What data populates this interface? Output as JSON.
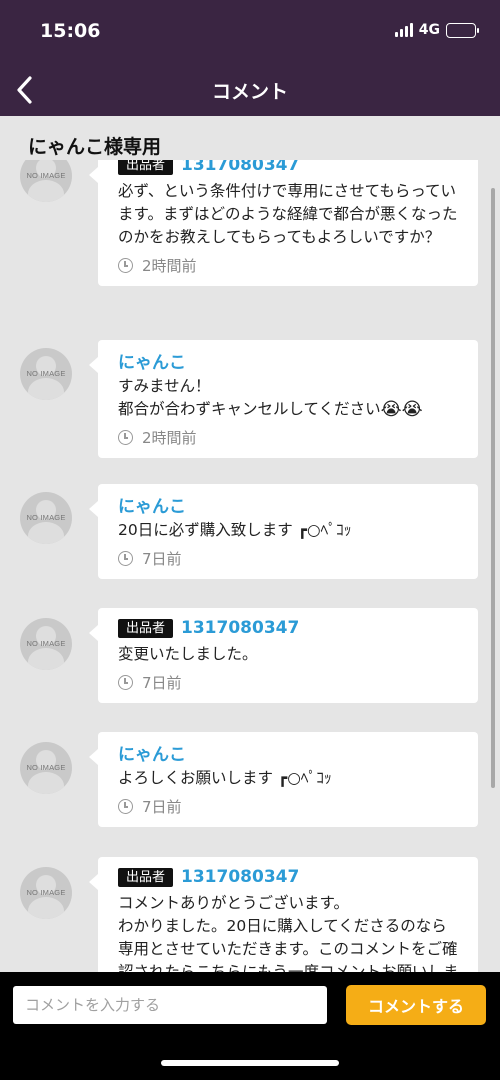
{
  "status_bar": {
    "time": "15:06",
    "network": "4G"
  },
  "nav": {
    "title": "コメント",
    "back_icon": "chevron-left-icon"
  },
  "section": {
    "title": "にゃんこ様専用"
  },
  "avatar_placeholder": "NO IMAGE",
  "seller_badge": "出品者",
  "comments": [
    {
      "author": "1317080347",
      "is_seller": true,
      "text": "必ず、という条件付けで専用にさせてもらっています。まずはどのような経緯で都合が悪くなったのかをお教えしてもらってもよろしいですか？",
      "time": "2時間前"
    },
    {
      "author": "にゃんこ",
      "is_seller": false,
      "text": "すみません！\n都合が合わずキャンセルしてください",
      "emoji": "😭😭",
      "time": "2時間前"
    },
    {
      "author": "にゃんこ",
      "is_seller": false,
      "text": "20日に必ず購入致します ┏○ﾍﾟｺｯ",
      "time": "7日前"
    },
    {
      "author": "1317080347",
      "is_seller": true,
      "text": "変更いたしました。",
      "time": "7日前"
    },
    {
      "author": "にゃんこ",
      "is_seller": false,
      "text": "よろしくお願いします ┏○ﾍﾟｺｯ",
      "time": "7日前"
    },
    {
      "author": "1317080347",
      "is_seller": true,
      "text": "コメントありがとうございます。\nわかりました。20日に購入してくださるのなら専用とさせていただきます。このコメントをご確認されたらこちらにもう一度コメントお願いします。",
      "time": ""
    }
  ],
  "composer": {
    "placeholder": "コメントを入力する",
    "submit_label": "コメントする"
  },
  "colors": {
    "header_bg": "#3a2542",
    "author_blue": "#2b9bd6",
    "submit_orange": "#f5ad16"
  }
}
